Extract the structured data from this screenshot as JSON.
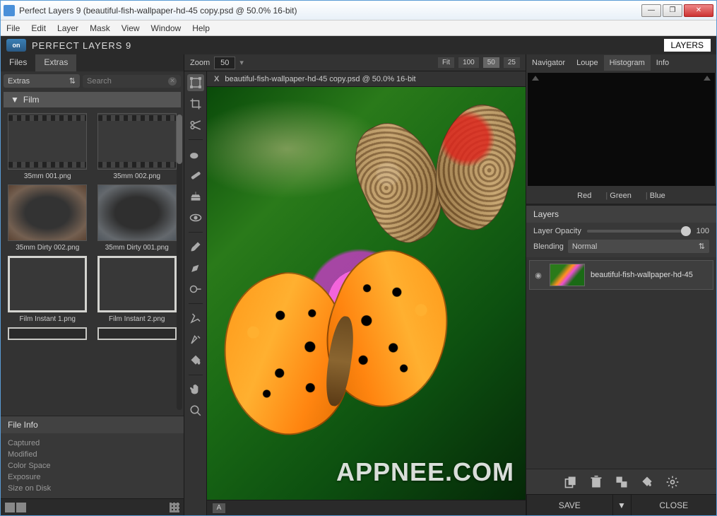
{
  "window": {
    "title": "Perfect Layers 9 (beautiful-fish-wallpaper-hd-45 copy.psd @ 50.0% 16-bit)"
  },
  "menubar": [
    "File",
    "Edit",
    "Layer",
    "Mask",
    "View",
    "Window",
    "Help"
  ],
  "brand": {
    "logo": "on",
    "title": "PERFECT LAYERS 9",
    "layers_btn": "LAYERS"
  },
  "left": {
    "tabs": [
      "Files",
      "Extras"
    ],
    "active_tab": 1,
    "filter": {
      "select": "Extras",
      "search_placeholder": "Search"
    },
    "section": "Film",
    "thumbs": [
      {
        "label": "35mm 001.png",
        "kind": "film"
      },
      {
        "label": "35mm 002.png",
        "kind": "film"
      },
      {
        "label": "35mm Dirty 002.png",
        "kind": "dirty"
      },
      {
        "label": "35mm Dirty  001.png",
        "kind": "dirty2"
      },
      {
        "label": "Film Instant 1.png",
        "kind": "instant"
      },
      {
        "label": "Film Instant 2.png",
        "kind": "instant"
      }
    ],
    "file_info": {
      "title": "File Info",
      "rows": [
        "Captured",
        "Modified",
        "Color Space",
        "Exposure",
        "Size on Disk"
      ]
    }
  },
  "center": {
    "zoom_label": "Zoom",
    "zoom_value": "50",
    "presets": [
      "Fit",
      "100",
      "50",
      "25"
    ],
    "active_preset": 2,
    "doc_tab": "beautiful-fish-wallpaper-hd-45 copy.psd @ 50.0% 16-bit",
    "footer_letter": "A",
    "watermark": "APPNEE.COM"
  },
  "right": {
    "tabs": [
      "Navigator",
      "Loupe",
      "Histogram",
      "Info"
    ],
    "active_tab": 2,
    "channels": [
      "Red",
      "Green",
      "Blue"
    ],
    "layers_title": "Layers",
    "opacity_label": "Layer Opacity",
    "opacity_value": "100",
    "blending_label": "Blending",
    "blending_value": "Normal",
    "layer_item": {
      "name": "beautiful-fish-wallpaper-hd-45"
    },
    "save": "SAVE",
    "close": "CLOSE"
  }
}
